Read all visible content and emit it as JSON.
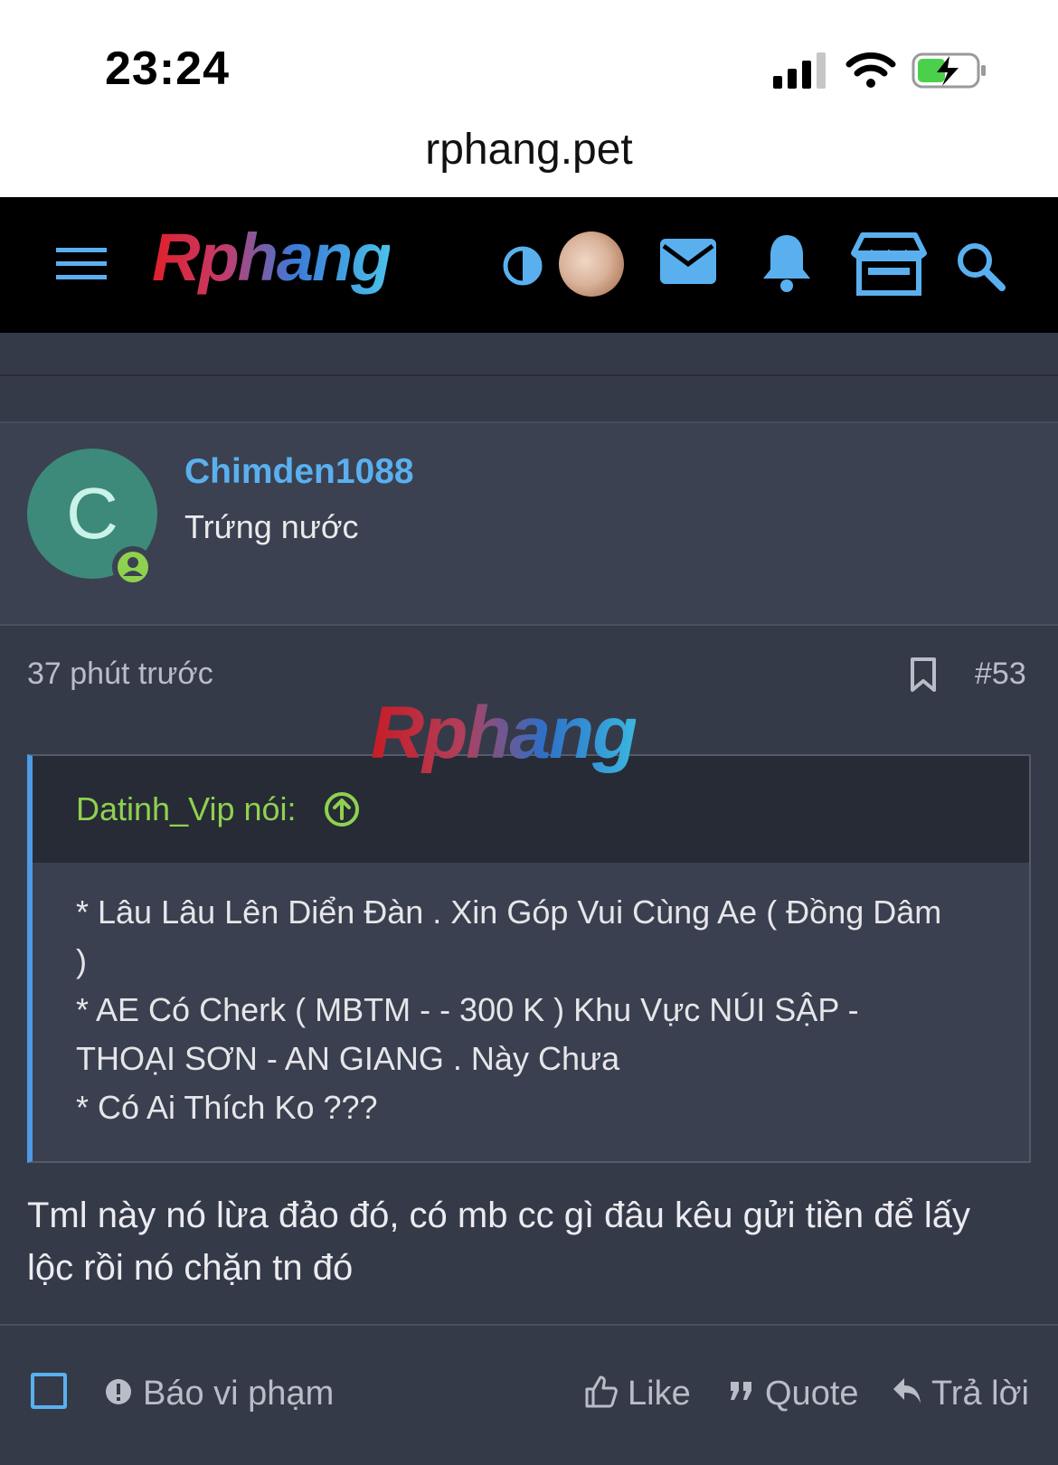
{
  "status_bar": {
    "time": "23:24",
    "url": "rphang.pet"
  },
  "nav": {
    "logo": "Rphang",
    "icons": [
      "menu-icon",
      "theme-toggle-icon",
      "avatar",
      "mail-icon",
      "bell-icon",
      "store-icon",
      "search-icon"
    ]
  },
  "author": {
    "avatar_letter": "C",
    "username": "Chimden1088",
    "title": "Trứng nước",
    "avatar_color": "#3d8a7a"
  },
  "post": {
    "time": "37 phút trước",
    "number": "#53",
    "watermark": "Rphang",
    "quote": {
      "author": "Datinh_Vip nói:",
      "lines": [
        "* Lâu Lâu Lên Diển Đàn . Xin Góp Vui Cùng Ae ( Đồng Dâm",
        ")",
        "* AE Có Cherk ( MBTM - - 300 K ) Khu Vực NÚI SẬP -",
        "THOẠI SƠN - AN GIANG . Này Chưa",
        "* Có Ai Thích Ko ???"
      ]
    },
    "body": [
      "Tml này nó lừa đảo đó, có mb cc gì đâu kêu gửi tiền để lấy",
      "lộc rồi nó chặn tn đó"
    ]
  },
  "actions": {
    "report": "Báo vi phạm",
    "like": "Like",
    "quote": "Quote",
    "reply": "Trả lời"
  },
  "colors": {
    "accent": "#5ab0ef",
    "quote_author": "#8fd14f",
    "bg": "#353a49"
  }
}
